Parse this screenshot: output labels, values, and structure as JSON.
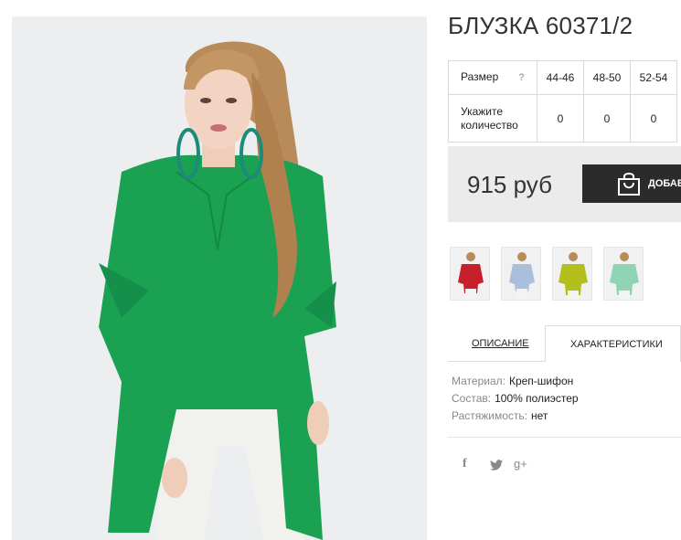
{
  "product": {
    "title": "БЛУЗКА 60371/2",
    "price": "915 руб",
    "add_to_cart_label": "ДОБАВ"
  },
  "size_table": {
    "size_label": "Размер",
    "help_icon": "?",
    "sizes": [
      "44-46",
      "48-50",
      "52-54"
    ],
    "quantity_label_line1": "Укажите",
    "quantity_label_line2": "количество",
    "quantities": [
      "0",
      "0",
      "0"
    ]
  },
  "color_variants": [
    "red",
    "light-blue",
    "lime",
    "mint"
  ],
  "tabs": {
    "description": "ОПИСАНИЕ",
    "characteristics": "ХАРАКТЕРИСТИКИ"
  },
  "specs": [
    {
      "key": "Материал:",
      "value": "Креп-шифон"
    },
    {
      "key": "Состав:",
      "value": "100% полиэстер"
    },
    {
      "key": "Растяжимость:",
      "value": "нет"
    }
  ],
  "social": {
    "facebook": "f",
    "twitter_icon": "twitter-icon",
    "google_plus": "g+"
  },
  "colors": {
    "blouse_green": "#1aa152",
    "price_box_bg": "#ebebeb",
    "cart_button": "#2b2b2b"
  }
}
